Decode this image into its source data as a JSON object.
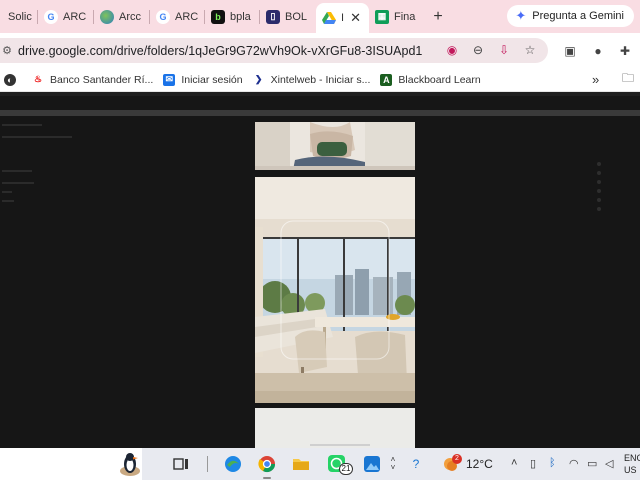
{
  "browser": {
    "tabs": [
      {
        "label": "Solic",
        "icon": "notion-icon"
      },
      {
        "label": "ARC",
        "icon": "google-icon"
      },
      {
        "label": "Arcc",
        "icon": "globe-icon"
      },
      {
        "label": "ARC",
        "icon": "google-icon"
      },
      {
        "label": "bpla",
        "icon": "b-icon"
      },
      {
        "label": "BOL",
        "icon": "doc-icon"
      },
      {
        "label": "I",
        "icon": "google-drive-icon",
        "active": true
      },
      {
        "label": "Fina",
        "icon": "sheets-icon"
      }
    ],
    "gemini_label": "Pregunta a Gemini",
    "url": "drive.google.com/drive/folders/1qJeGr9G72wVh9Ok-vXrGFu8-3ISUApd1"
  },
  "bookmarks": [
    {
      "label": "Banco Santander Rí...",
      "icon": "santander-icon"
    },
    {
      "label": "Iniciar sesión",
      "icon": "mail-icon"
    },
    {
      "label": "Xintelweb - Iniciar s...",
      "icon": "xintel-icon"
    },
    {
      "label": "Blackboard Learn",
      "icon": "blackboard-icon"
    }
  ],
  "taskbar": {
    "whatsapp_badge": "21",
    "weather_badge": "2",
    "temperature": "12°C",
    "lang_line1": "ENG",
    "lang_line2": "US"
  },
  "colors": {
    "tab_strip": "#f9dde3",
    "viewer_bg": "#161616",
    "taskbar": "#e8eaf0"
  }
}
